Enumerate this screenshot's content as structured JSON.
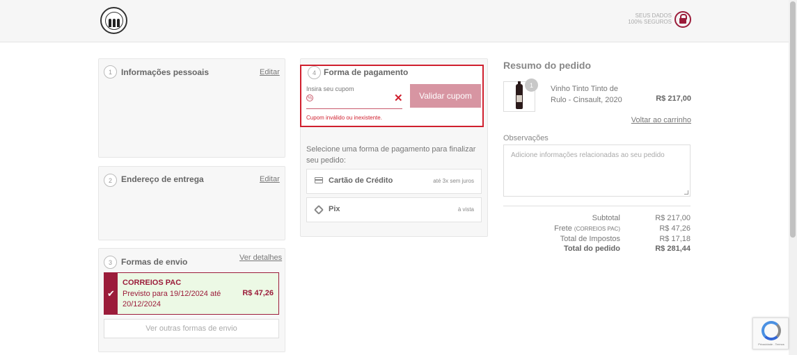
{
  "header": {
    "logo_icon": "winery-logo-icon",
    "secure_line1": "SEUS DADOS",
    "secure_line2": "100% SEGUROS",
    "lock_icon": "lock-icon"
  },
  "personal": {
    "step": "1",
    "title": "Informações pessoais",
    "edit": "Editar"
  },
  "address": {
    "step": "2",
    "title": "Endereço de entrega",
    "edit": "Editar"
  },
  "shipping": {
    "step": "3",
    "title": "Formas de envio",
    "details_link": "Ver detalhes",
    "selected_name": "CORREIOS PAC",
    "selected_desc": "Previsto para 19/12/2024 até 20/12/2024",
    "selected_price": "R$ 47,26",
    "other_options": "Ver outras formas de envio"
  },
  "payment": {
    "step": "4",
    "title": "Forma de pagamento",
    "coupon_label": "Insira seu cupom",
    "coupon_value": "",
    "validate_button": "Validar cupom",
    "coupon_error": "Cupom inválido ou inexistente.",
    "prompt": "Selecione uma forma de pagamento para finalizar seu pedido:",
    "options": [
      {
        "name": "Cartão de Crédito",
        "note": "até 3x sem juros",
        "icon": "credit-card-icon"
      },
      {
        "name": "Pix",
        "note": "à vista",
        "icon": "pix-icon"
      }
    ]
  },
  "summary": {
    "title": "Resumo do pedido",
    "product": {
      "quantity": "1",
      "name": "Vinho Tinto Tinto de Rulo - Cinsault, 2020",
      "price": "R$ 217,00"
    },
    "back_to_cart": "Voltar ao carrinho",
    "observations_label": "Observações",
    "observations_placeholder": "Adicione informações relacionadas ao seu pedido",
    "subtotal_label": "Subtotal",
    "subtotal_value": "R$ 217,00",
    "freight_label": "Frete",
    "freight_carrier": "(CORREIOS PAC)",
    "freight_value": "R$ 47,26",
    "taxes_label": "Total de Impostos",
    "taxes_value": "R$ 17,18",
    "total_label": "Total do pedido",
    "total_value": "R$ 281,44"
  },
  "recaptcha": {
    "text": "Privacidade - Termos"
  },
  "colors": {
    "brand": "#9b1c3a",
    "error": "#d01f2e",
    "button": "#d795a2",
    "selected_bg": "#ecf9e5"
  }
}
